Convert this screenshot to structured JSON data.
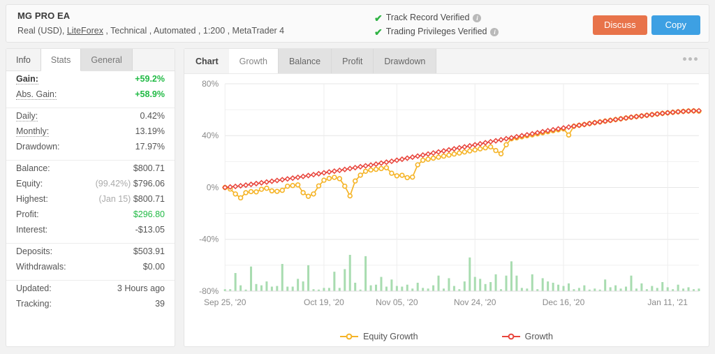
{
  "header": {
    "title": "MG PRO EA",
    "subtitle_pre": "Real (USD), ",
    "broker": "LiteForex",
    "subtitle_post": " , Technical , Automated , 1:200 , MetaTrader 4",
    "verifications": [
      {
        "label": "Track Record Verified",
        "icon": "check-icon",
        "info": "i"
      },
      {
        "label": "Trading Privileges Verified",
        "icon": "check-icon",
        "info": "i"
      }
    ],
    "buttons": {
      "discuss": "Discuss",
      "copy": "Copy"
    },
    "colors": {
      "discuss": "#e8734a",
      "copy": "#3da0e3",
      "check": "#2fb344"
    }
  },
  "sidebar": {
    "tabs": [
      {
        "label": "Info",
        "active": false
      },
      {
        "label": "Stats",
        "active": true
      },
      {
        "label": "General",
        "active": false
      }
    ],
    "groups": [
      {
        "rows": [
          {
            "label": "Gain:",
            "value": "+59.2%",
            "style": "green",
            "label_style": "bold dotted"
          },
          {
            "label": "Abs. Gain:",
            "value": "+58.9%",
            "style": "green",
            "label_style": "dotted"
          }
        ]
      },
      {
        "rows": [
          {
            "label": "Daily:",
            "value": "0.42%",
            "style": "",
            "label_style": "dotted"
          },
          {
            "label": "Monthly:",
            "value": "13.19%",
            "style": "",
            "label_style": "dotted"
          },
          {
            "label": "Drawdown:",
            "value": "17.97%",
            "style": "",
            "label_style": ""
          }
        ]
      },
      {
        "rows": [
          {
            "label": "Balance:",
            "value": "$800.71",
            "style": "",
            "label_style": ""
          },
          {
            "label": "Equity:",
            "value": "$796.06",
            "prefix": "(99.42%)",
            "style": "",
            "label_style": ""
          },
          {
            "label": "Highest:",
            "value": "$800.71",
            "prefix": "(Jan 15)",
            "style": "",
            "label_style": ""
          },
          {
            "label": "Profit:",
            "value": "$296.80",
            "style": "green-n",
            "label_style": ""
          },
          {
            "label": "Interest:",
            "value": "-$13.05",
            "style": "",
            "label_style": ""
          }
        ]
      },
      {
        "rows": [
          {
            "label": "Deposits:",
            "value": "$503.91",
            "style": "",
            "label_style": ""
          },
          {
            "label": "Withdrawals:",
            "value": "$0.00",
            "style": "",
            "label_style": ""
          }
        ]
      },
      {
        "rows": [
          {
            "label": "Updated:",
            "value": "3 Hours ago",
            "style": "",
            "label_style": ""
          },
          {
            "label": "Tracking:",
            "value": "39",
            "style": "",
            "label_style": ""
          }
        ]
      }
    ]
  },
  "panel": {
    "heading": "Chart",
    "tabs": [
      {
        "label": "Growth",
        "active": true
      },
      {
        "label": "Balance",
        "active": false
      },
      {
        "label": "Profit",
        "active": false
      },
      {
        "label": "Drawdown",
        "active": false
      }
    ],
    "menu_icon": "more-options-icon"
  },
  "chart_data": {
    "type": "line",
    "title": "",
    "xlabel": "",
    "ylabel": "",
    "ylim": [
      -80,
      80
    ],
    "yticks": [
      80,
      40,
      0,
      -40,
      -80
    ],
    "ytick_labels": [
      "80%",
      "40%",
      "0%",
      "-40%",
      "-80%"
    ],
    "grid": true,
    "legend_position": "bottom",
    "xtick_labels": [
      "Sep 25, '20",
      "Oct 19, '20",
      "Nov 05, '20",
      "Nov 24, '20",
      "Dec 16, '20",
      "Jan 11, '21"
    ],
    "xtick_positions": [
      0,
      19,
      33,
      48,
      65,
      85
    ],
    "n_points": 92,
    "series": [
      {
        "name": "Growth",
        "color": "#e8453c",
        "marker": "diamond",
        "values": [
          0.0,
          0.4,
          0.8,
          1.3,
          1.8,
          2.4,
          3.0,
          3.6,
          4.2,
          4.8,
          5.4,
          6.0,
          6.6,
          7.2,
          7.8,
          8.5,
          9.2,
          9.9,
          10.6,
          11.3,
          12.0,
          12.6,
          13.2,
          13.9,
          14.6,
          15.3,
          16.0,
          16.7,
          17.3,
          18.0,
          18.8,
          19.5,
          20.2,
          21.0,
          21.8,
          22.6,
          23.4,
          24.2,
          25.0,
          25.8,
          26.6,
          27.4,
          28.2,
          29.0,
          29.8,
          30.6,
          31.3,
          32.1,
          32.9,
          33.7,
          34.5,
          35.3,
          36.0,
          36.8,
          37.6,
          38.3,
          39.1,
          39.9,
          40.6,
          41.4,
          42.2,
          43.0,
          43.8,
          44.5,
          45.2,
          45.9,
          46.6,
          47.3,
          48.0,
          48.6,
          49.3,
          50.0,
          50.6,
          51.2,
          51.8,
          52.4,
          53.0,
          53.6,
          54.2,
          54.7,
          55.2,
          55.7,
          56.2,
          56.7,
          57.2,
          57.6,
          58.0,
          58.4,
          58.7,
          59.0,
          59.1,
          59.2
        ]
      },
      {
        "name": "Equity Growth",
        "color": "#f5b427",
        "marker": "circle",
        "values": [
          0.0,
          -1.2,
          -5.0,
          -8.0,
          -4.0,
          -3.2,
          -3.4,
          -1.4,
          -0.6,
          -2.6,
          -3.0,
          -2.2,
          1.0,
          1.5,
          2.0,
          -4.0,
          -6.8,
          -5.0,
          1.2,
          5.6,
          7.0,
          7.8,
          6.8,
          1.0,
          -6.5,
          5.0,
          9.5,
          12.5,
          13.5,
          14.0,
          14.6,
          15.2,
          11.0,
          9.0,
          9.4,
          7.6,
          8.0,
          17.5,
          21.0,
          21.8,
          22.6,
          23.4,
          24.2,
          25.0,
          25.8,
          26.6,
          27.4,
          28.2,
          29.0,
          29.8,
          30.6,
          31.3,
          28.5,
          26.0,
          33.0,
          37.6,
          38.3,
          39.1,
          39.9,
          40.6,
          41.4,
          42.2,
          43.0,
          43.8,
          44.5,
          45.2,
          40.5,
          47.3,
          48.0,
          48.6,
          49.3,
          50.0,
          50.6,
          51.2,
          51.8,
          52.4,
          53.0,
          53.6,
          54.2,
          54.7,
          55.2,
          55.7,
          56.2,
          56.7,
          57.2,
          57.6,
          58.0,
          58.4,
          58.7,
          59.0,
          59.1,
          58.9
        ]
      }
    ],
    "volume_series": {
      "name": "volume",
      "color": "#a8dcb0",
      "baseline": -80,
      "max": 40,
      "values": [
        1.5,
        1.5,
        14,
        4.5,
        1.2,
        19,
        5.5,
        4.5,
        7.5,
        3.5,
        4.0,
        21,
        3.5,
        3.5,
        9.5,
        7.5,
        20,
        1.5,
        1.2,
        2.5,
        2.5,
        15,
        2.5,
        17,
        28,
        6.5,
        1.2,
        27,
        4.5,
        5.0,
        11,
        3.5,
        9.0,
        4.0,
        3.5,
        5.0,
        2.0,
        6.5,
        2.5,
        2.0,
        4.5,
        12,
        2.0,
        10,
        4.0,
        1.5,
        7.5,
        26,
        11,
        9.5,
        5.5,
        7.0,
        13,
        1.5,
        12,
        23,
        12,
        2.5,
        2.0,
        13,
        1.5,
        10,
        7.5,
        6.5,
        5.0,
        4.0,
        6.0,
        1.5,
        2.5,
        4.5,
        1.2,
        2.0,
        1.2,
        9.0,
        3.0,
        4.5,
        2.0,
        3.5,
        12,
        2.0,
        6.0,
        1.5,
        4.0,
        2.5,
        7.0,
        3.0,
        1.5,
        5.0,
        2.0,
        3.0,
        1.5,
        2.0
      ]
    },
    "legend": [
      {
        "label": "Equity Growth",
        "color": "#f5b427",
        "marker": "circle"
      },
      {
        "label": "Growth",
        "color": "#e8453c",
        "marker": "diamond"
      }
    ]
  }
}
